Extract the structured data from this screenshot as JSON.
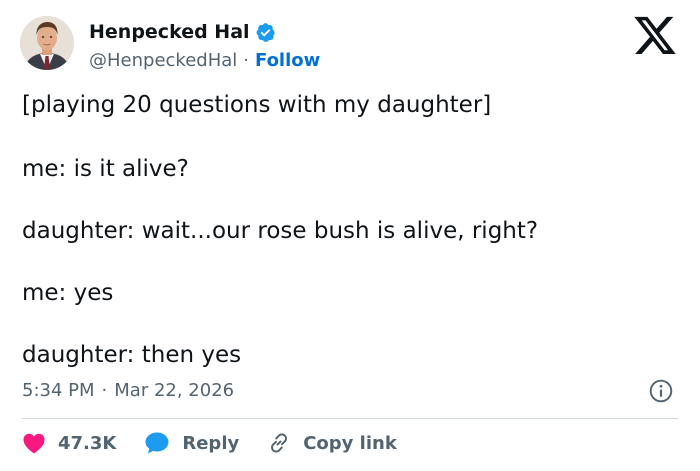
{
  "author": {
    "display_name": "Henpecked Hal",
    "handle": "@HenpeckedHal",
    "follow_label": "Follow",
    "separator": "·"
  },
  "platform": {
    "logo": "x-logo-icon"
  },
  "tweet": {
    "lines": [
      "[playing 20 questions with my daughter]",
      "me: is it alive?",
      "daughter: wait...our rose bush is alive, right?",
      "me: yes",
      "daughter: then yes"
    ],
    "time": "5:34 PM",
    "date": "Mar 22, 2026",
    "separator": "·"
  },
  "actions": {
    "like_count": "47.3K",
    "reply_label": "Reply",
    "copy_link_label": "Copy link"
  },
  "colors": {
    "verified": "#1d9bf0",
    "follow": "#006fd6",
    "like": "#f91880",
    "reply": "#1d9bf0",
    "secondary_text": "#536471"
  },
  "icons": [
    "verified-badge-icon",
    "x-logo-icon",
    "info-icon",
    "heart-icon",
    "reply-bubble-icon",
    "link-icon"
  ]
}
